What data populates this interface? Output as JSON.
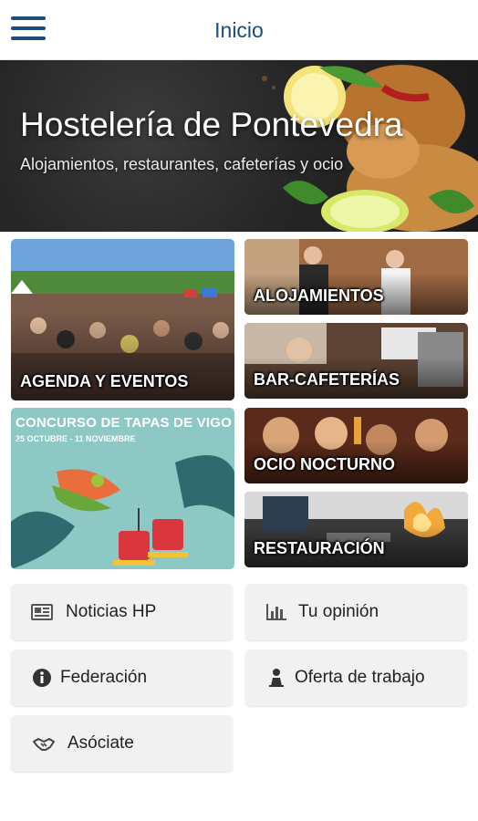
{
  "appbar": {
    "title": "Inicio",
    "menu_icon": "hamburger-menu-icon"
  },
  "hero": {
    "title": "Hostelería de Pontevedra",
    "subtitle": "Alojamientos, restaurantes, cafeterías y ocio"
  },
  "tiles": {
    "agenda": {
      "label": "AGENDA Y EVENTOS"
    },
    "alojamientos": {
      "label": "ALOJAMIENTOS"
    },
    "bar": {
      "label": "BAR-CAFETERÍAS"
    },
    "ocio": {
      "label": "OCIO NOCTURNO"
    },
    "restauracion": {
      "label": "RESTAURACIÓN"
    },
    "tapas": {
      "title": "CONCURSO DE TAPAS DE VIGO",
      "dates": "25 OCTUBRE - 11 NOVIEMBRE"
    }
  },
  "buttons": {
    "noticias": {
      "label": "Noticias HP",
      "icon": "newspaper-icon"
    },
    "opinion": {
      "label": "Tu opinión",
      "icon": "bar-chart-icon"
    },
    "federacion": {
      "label": "Federación",
      "icon": "info-icon"
    },
    "oferta": {
      "label": "Oferta de trabajo",
      "icon": "worker-icon"
    },
    "asociate": {
      "label": "Asóciate",
      "icon": "handshake-icon"
    }
  },
  "colors": {
    "brand": "#1b4c80",
    "button_bg": "#f1f1f1",
    "tapas_bg": "#8ec8c4"
  }
}
